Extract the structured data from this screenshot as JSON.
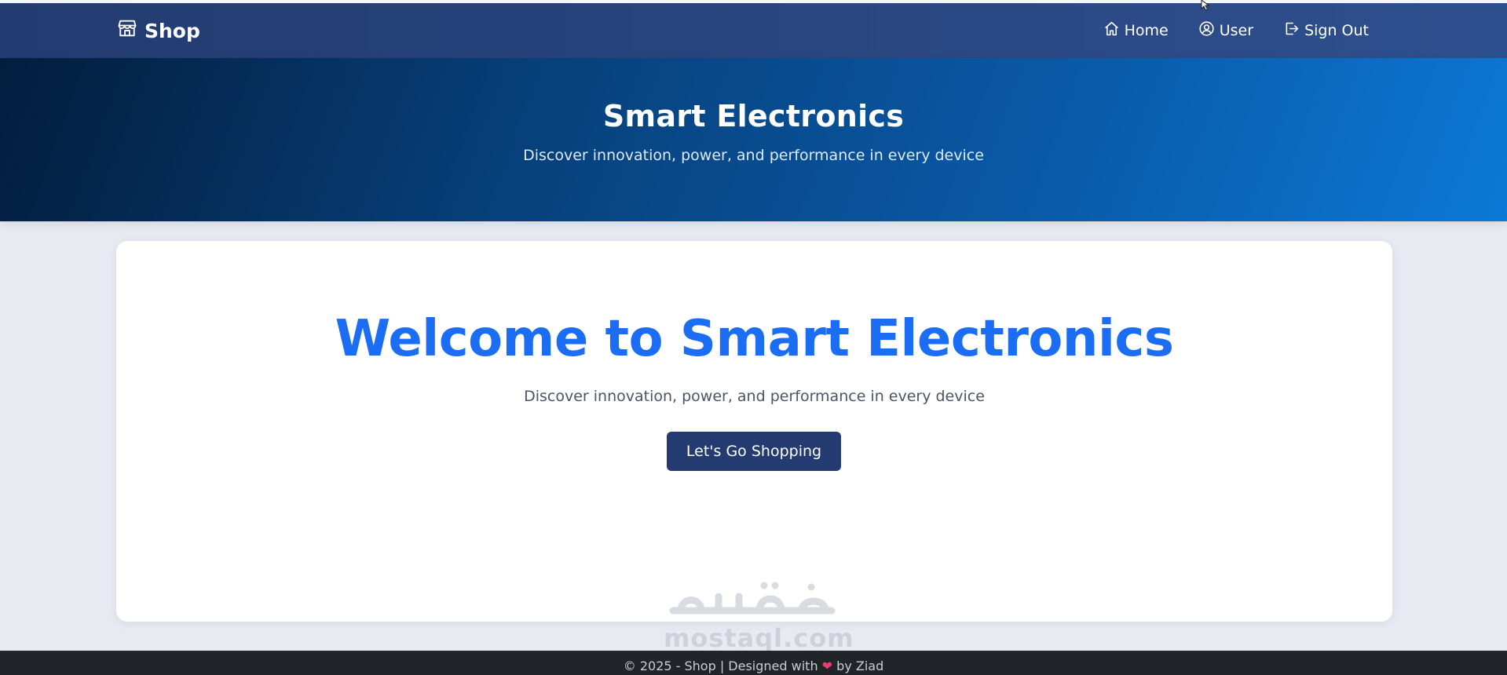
{
  "navbar": {
    "brand_label": "Shop",
    "brand_icon": "store-icon",
    "links": [
      {
        "label": "Home",
        "icon": "home-icon"
      },
      {
        "label": "User",
        "icon": "user-circle-icon"
      },
      {
        "label": "Sign Out",
        "icon": "sign-out-icon"
      }
    ]
  },
  "hero": {
    "title": "Smart Electronics",
    "subtitle": "Discover innovation, power, and performance in every device"
  },
  "main": {
    "title": "Welcome to Smart Electronics",
    "subtitle": "Discover innovation, power, and performance in every device",
    "button_label": "Let's Go Shopping"
  },
  "watermark": {
    "latin": "mostaql.com"
  },
  "footer": {
    "text_before": "© 2025 - Shop | Designed with",
    "text_after": "by Ziad"
  },
  "colors": {
    "nav_bg": "#2a4580",
    "accent_blue": "#1b6ef3",
    "button_bg": "#233b70",
    "footer_bg": "#212529",
    "heart": "#e83e6c"
  }
}
